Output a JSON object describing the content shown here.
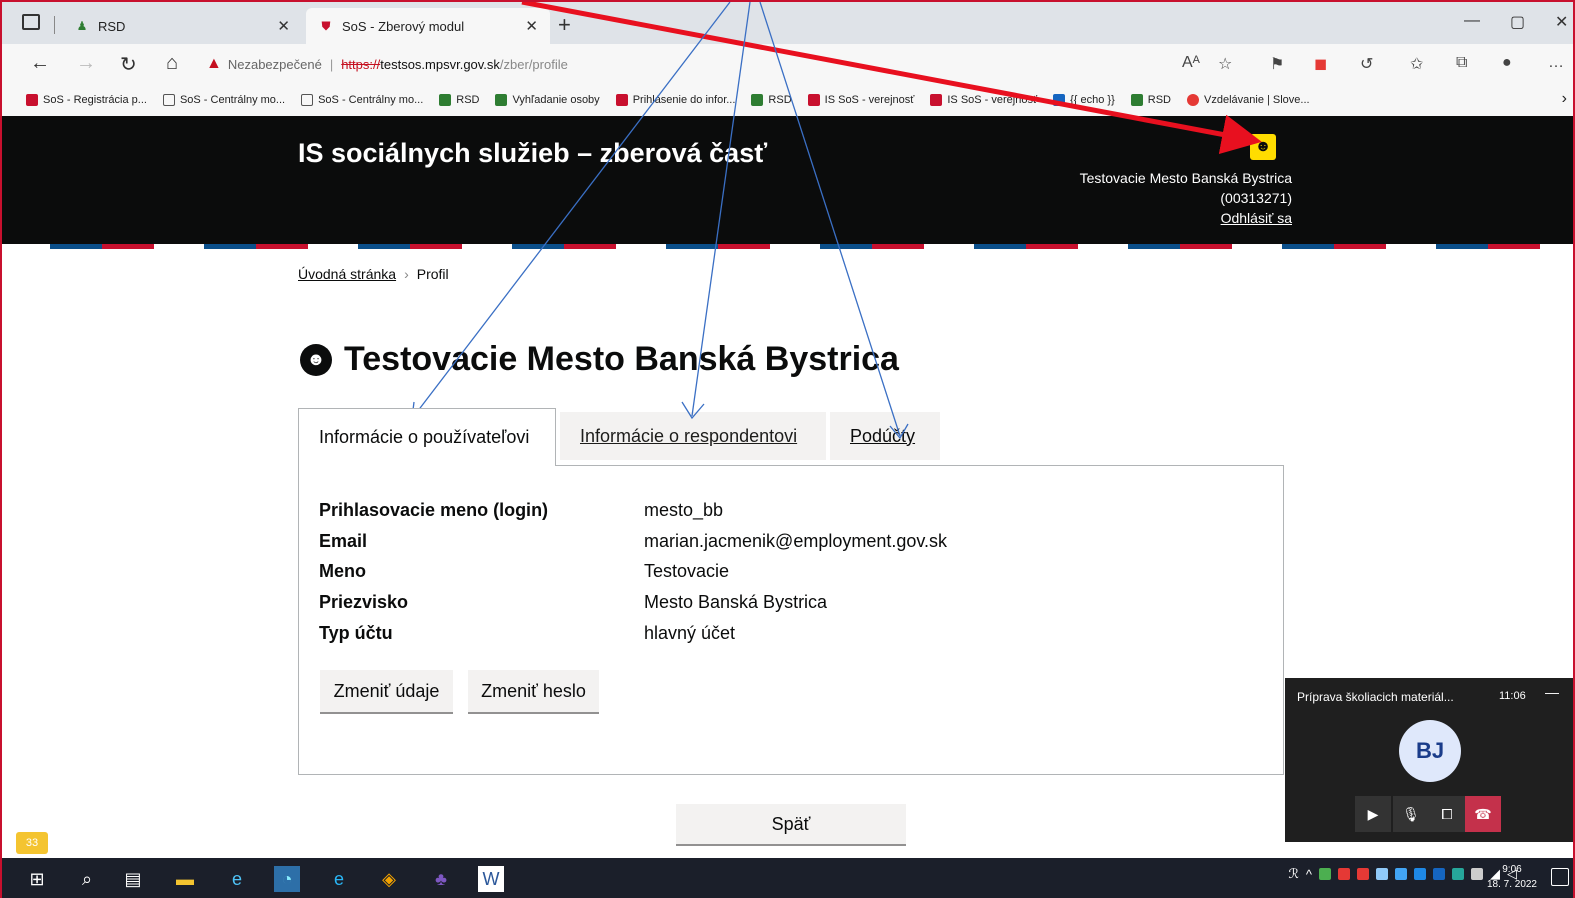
{
  "browser": {
    "tabs": [
      {
        "title": "RSD",
        "active": false
      },
      {
        "title": "SoS - Zberový modul",
        "active": true
      }
    ],
    "address": {
      "security": "Nezabezpečené",
      "scheme": "https://",
      "host": "testsos.mpsvr.gov.sk",
      "path": "/zber/profile"
    },
    "bookmarks": [
      "SoS - Registrácia p...",
      "SoS - Centrálny mo...",
      "SoS - Centrálny mo...",
      "RSD",
      "Vyhľadanie osoby",
      "Prihlásenie do infor...",
      "RSD",
      "IS SoS - verejnosť",
      "IS SoS - verejnosť",
      "{{ echo }}",
      "RSD",
      "Vzdelávanie | Slove..."
    ]
  },
  "header": {
    "title": "IS sociálnych služieb – zberová časť",
    "user_name": "Testovacie Mesto Banská Bystrica",
    "user_ico": "(00313271)",
    "logout": "Odhlásiť sa"
  },
  "breadcrumb": {
    "home": "Úvodná stránka",
    "current": "Profil"
  },
  "page": {
    "title": "Testovacie Mesto Banská Bystrica",
    "tabs": [
      "Informácie o používateľovi",
      "Informácie o respondentovi",
      "Podúčty"
    ],
    "fields": [
      {
        "label": "Prihlasovacie meno (login)",
        "value": "mesto_bb"
      },
      {
        "label": "Email",
        "value": "marian.jacmenik@employment.gov.sk"
      },
      {
        "label": "Meno",
        "value": "Testovacie"
      },
      {
        "label": "Priezvisko",
        "value": "Mesto Banská Bystrica"
      },
      {
        "label": "Typ účtu",
        "value": "hlavný účet"
      }
    ],
    "change_data_btn": "Zmeniť údaje",
    "change_pwd_btn": "Zmeniť heslo",
    "back_btn": "Späť"
  },
  "meeting": {
    "title": "Príprava školiacich materiál...",
    "time": "11:06",
    "initials": "BJ"
  },
  "badge": "33",
  "taskbar": {
    "time": "9:06",
    "date": "18. 7. 2022"
  },
  "colors": {
    "header_bg": "#0b0c0c",
    "user_icon": "#ffdd00",
    "annotation_red": "#e8101f",
    "annotation_blue": "#3a6fc4"
  }
}
